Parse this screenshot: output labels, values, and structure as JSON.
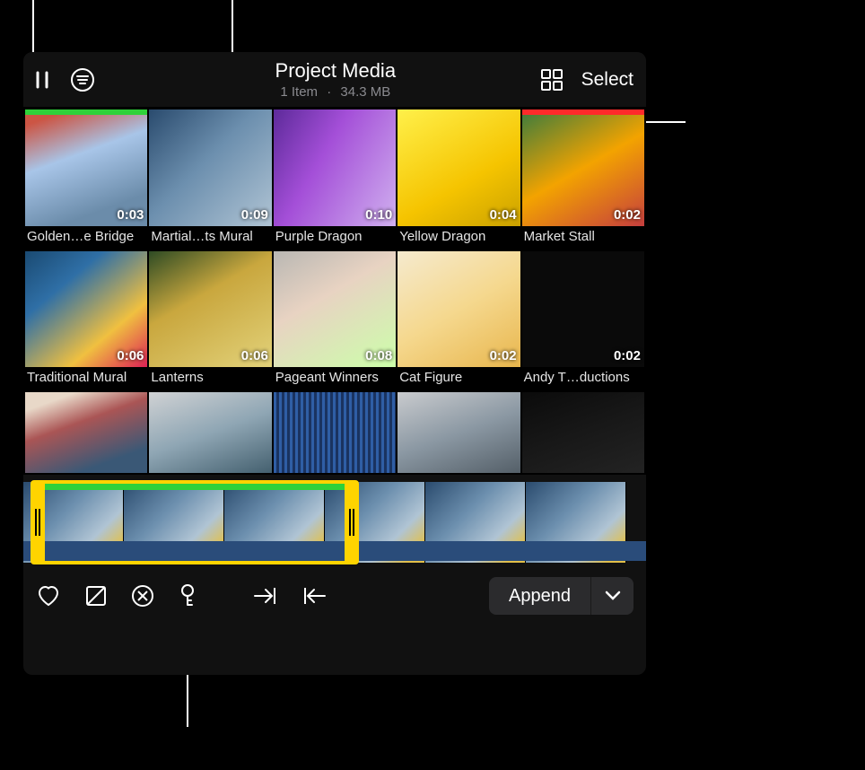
{
  "header": {
    "title": "Project Media",
    "item_count": "1 Item",
    "dot": "·",
    "size": "34.3 MB",
    "select_label": "Select"
  },
  "clips": [
    {
      "label": "Golden…e Bridge",
      "duration": "0:03",
      "tag": "green",
      "selected": false
    },
    {
      "label": "Martial…ts Mural",
      "duration": "0:09",
      "tag": "",
      "selected": true
    },
    {
      "label": "Purple Dragon",
      "duration": "0:10",
      "tag": "",
      "selected": false
    },
    {
      "label": "Yellow Dragon",
      "duration": "0:04",
      "tag": "",
      "selected": false
    },
    {
      "label": "Market Stall",
      "duration": "0:02",
      "tag": "red",
      "selected": false
    },
    {
      "label": "Traditional Mural",
      "duration": "0:06",
      "tag": "",
      "selected": false
    },
    {
      "label": "Lanterns",
      "duration": "0:06",
      "tag": "",
      "selected": false
    },
    {
      "label": "Pageant Winners",
      "duration": "0:08",
      "tag": "",
      "selected": false
    },
    {
      "label": "Cat Figure",
      "duration": "0:02",
      "tag": "",
      "selected": false
    },
    {
      "label": "Andy T…ductions",
      "duration": "0:02",
      "tag": "",
      "selected": false
    }
  ],
  "toolbar": {
    "append_label": "Append"
  }
}
